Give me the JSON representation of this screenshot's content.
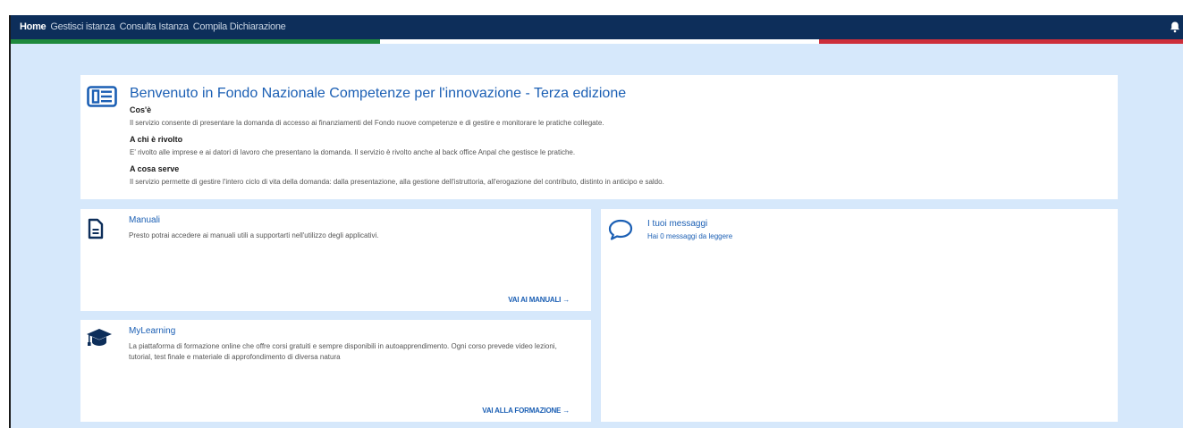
{
  "nav": {
    "items": [
      {
        "label": "Home",
        "active": true
      },
      {
        "label": "Gestisci istanza",
        "active": false
      },
      {
        "label": "Consulta Istanza",
        "active": false
      },
      {
        "label": "Compila Dichiarazione",
        "active": false
      }
    ]
  },
  "icons": {
    "bell": "bell-icon",
    "welcome": "newspaper-icon",
    "manuali": "document-icon",
    "learning": "graduation-cap-icon",
    "messaggi": "speech-bubble-icon"
  },
  "colors": {
    "navbar": "#0d2e5a",
    "accent": "#1b5fb4",
    "background": "#d6e8fb",
    "flag_green": "#1f8a3d",
    "flag_red": "#cd2e3a"
  },
  "welcome": {
    "title": "Benvenuto in Fondo Nazionale Competenze per l'innovazione - Terza edizione",
    "sections": [
      {
        "heading": "Cos'è",
        "text": "Il servizio consente di presentare la domanda di accesso ai finanziamenti del Fondo nuove competenze e di gestire e monitorare le pratiche collegate."
      },
      {
        "heading": "A chi è rivolto",
        "text": "E' rivolto alle imprese e ai datori di lavoro che presentano la domanda. Il servizio è rivolto anche al back office Anpal che gestisce le pratiche."
      },
      {
        "heading": "A cosa serve",
        "text": "Il servizio permette di gestire l'intero ciclo di vita della domanda: dalla presentazione, alla gestione dell'istruttoria, all'erogazione del contributo, distinto in anticipo e saldo."
      }
    ]
  },
  "manuali": {
    "title": "Manuali",
    "text": "Presto potrai accedere ai manuali utili a supportarti nell'utilizzo degli applicativi.",
    "link": "VAI AI MANUALI →"
  },
  "learning": {
    "title": "MyLearning",
    "text": "La piattaforma di formazione online che offre corsi gratuiti e sempre disponibili in autoapprendimento. Ogni corso prevede video lezioni, tutorial, test finale e materiale di approfondimento di diversa natura",
    "link": "VAI ALLA FORMAZIONE →"
  },
  "messaggi": {
    "title": "I tuoi messaggi",
    "subtitle": "Hai 0 messaggi da leggere"
  }
}
